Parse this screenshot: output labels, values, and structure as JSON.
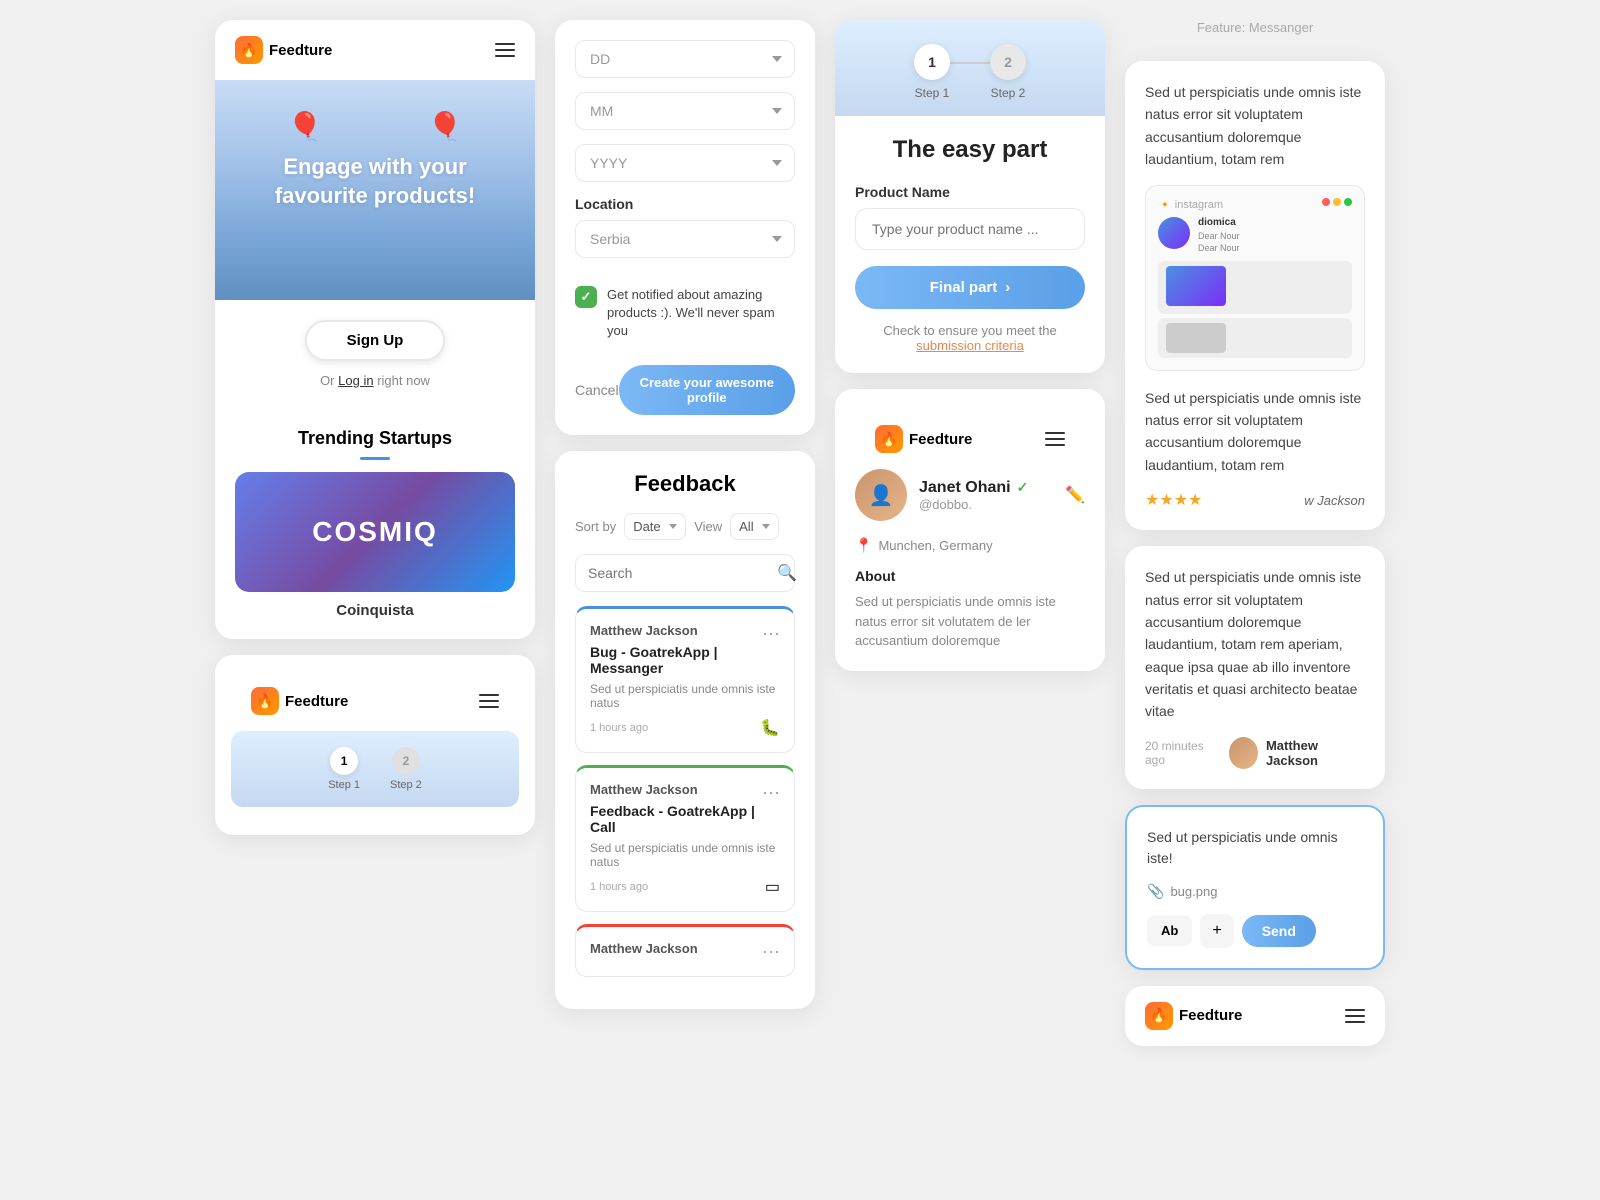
{
  "app": {
    "name": "Feedture",
    "tagline": "Engage with your favourite products!",
    "or_text": "Or",
    "login_text": "Log in",
    "right_now": "right now"
  },
  "landing": {
    "signup_btn": "Sign Up",
    "trending_title": "Trending Startups",
    "startup_name": "Coinquista",
    "cosmiq_text": "COSMIQ"
  },
  "form": {
    "dd_placeholder": "DD",
    "mm_placeholder": "MM",
    "yyyy_placeholder": "YYYY",
    "location_label": "Location",
    "location_value": "Serbia",
    "checkbox_text": "Get notified about amazing products :). We'll never spam you",
    "cancel_btn": "Cancel",
    "create_btn": "Create your awesome profile"
  },
  "feedback": {
    "title": "Feedback",
    "sort_by": "Sort by",
    "sort_value": "Date",
    "view_label": "View",
    "view_value": "All",
    "search_placeholder": "Search",
    "items": [
      {
        "user": "Matthew Jackson",
        "title": "Bug - GoatrekApp | Messanger",
        "desc": "Sed ut perspiciatis unde omnis iste natus",
        "time": "1 hours ago",
        "type": "bug",
        "bar": "blue"
      },
      {
        "user": "Matthew Jackson",
        "title": "Feedback - GoatrekApp | Call",
        "desc": "Sed ut perspiciatis unde omnis iste natus",
        "time": "1 hours ago",
        "type": "feedback",
        "bar": "green"
      },
      {
        "user": "Matthew Jackson",
        "title": "",
        "desc": "",
        "time": "",
        "type": "feedback",
        "bar": "red"
      }
    ]
  },
  "step": {
    "step1_label": "Step 1",
    "step2_label": "Step 2",
    "step1_num": "1",
    "step2_num": "2",
    "heading": "The easy part",
    "product_label": "Product Name",
    "product_placeholder": "Type your product name ...",
    "final_btn": "Final part",
    "check_text": "Check to ensure you meet the",
    "submission_link": "submission criteria"
  },
  "profile": {
    "name": "Janet Ohani",
    "handle": "@dobbo.",
    "location": "Munchen, Germany",
    "about_label": "About",
    "about_text": "Sed ut perspiciatis unde omnis iste natus error sit volutatem de ler accusantium doloremque"
  },
  "feature": {
    "label": "Feature: Messanger",
    "desc1": "Sed ut perspiciatis unde omnis iste natus error sit voluptatem accusantium doloremque laudantium, totam rem",
    "desc2": "Sed ut perspiciatis unde omnis iste natus error sit voluptatem accusantium doloremque laudantium, totam rem",
    "desc3": "Sed ut perspiciatis unde omnis iste natus error sit voluptatem accusantium doloremque laudantium, totam rem aperiam, eaque ipsa quae ab illo inventore veritatis et quasi architecto beatae vitae",
    "stars": "★★★★",
    "reviewer": "w Jackson",
    "review_time": "20 minutes ago",
    "reviewer_name": "Matthew Jackson"
  },
  "message": {
    "text": "Sed ut perspiciatis unde omnis iste!",
    "attachment": "bug.png",
    "ab_btn": "Ab",
    "plus_btn": "+",
    "send_btn": "Send"
  },
  "mini_step": {
    "step1_num": "1",
    "step2_num": "2",
    "step1_label": "Step 1",
    "step2_label": "Step 2"
  }
}
